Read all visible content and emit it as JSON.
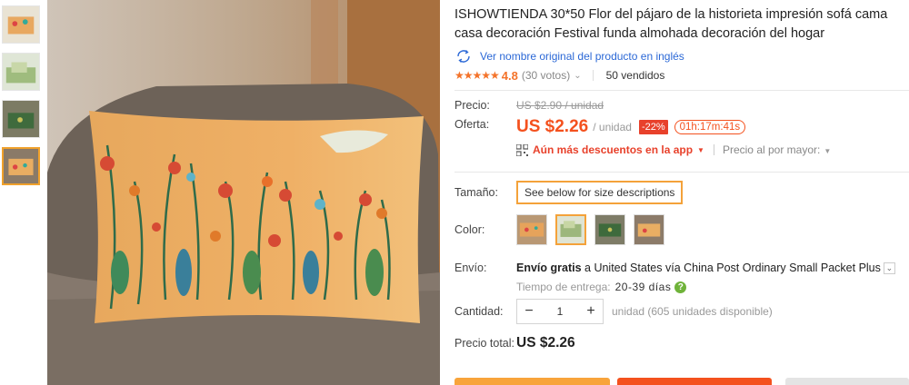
{
  "product": {
    "title": "ISHOWTIENDA 30*50 Flor del pájaro de la historieta impresión sofá cama casa decoración Festival funda almohada decoración del hogar",
    "original_name_link": "Ver nombre original del producto en inglés",
    "rating": "4.8",
    "votes": "(30 votos)",
    "sold": "50 vendidos",
    "stars": "★★★★★"
  },
  "price": {
    "old_label": "Precio:",
    "old_value": "US $2.90 / unidad",
    "offer_label": "Oferta:",
    "offer_value": "US $2.26",
    "per_unit": "/ unidad",
    "discount": "-22%",
    "timer": "01h:17m:41s",
    "app_discount": "Aún más descuentos en la app",
    "wholesale": "Precio al por mayor:"
  },
  "options": {
    "size_label": "Tamaño:",
    "size_value": "See below for size descriptions",
    "color_label": "Color:",
    "selected_color_index": 1
  },
  "shipping": {
    "label": "Envío:",
    "free": "Envío gratis",
    "to": " a ",
    "country": "United States",
    "via": " vía ",
    "carrier": "China Post Ordinary Small Packet Plus",
    "delivery_label": "Tiempo de entrega:",
    "delivery_days": "20-39 días"
  },
  "quantity": {
    "label": "Cantidad:",
    "value": "1",
    "minus": "−",
    "plus": "+",
    "available": "unidad (605 unidades disponible)"
  },
  "total": {
    "label": "Precio total:",
    "value": "US $2.26"
  },
  "colors": {
    "accent": "#f4511e",
    "selected_border": "#f4a23a",
    "link": "#2b68d6",
    "discount_bg": "#e8412b"
  }
}
